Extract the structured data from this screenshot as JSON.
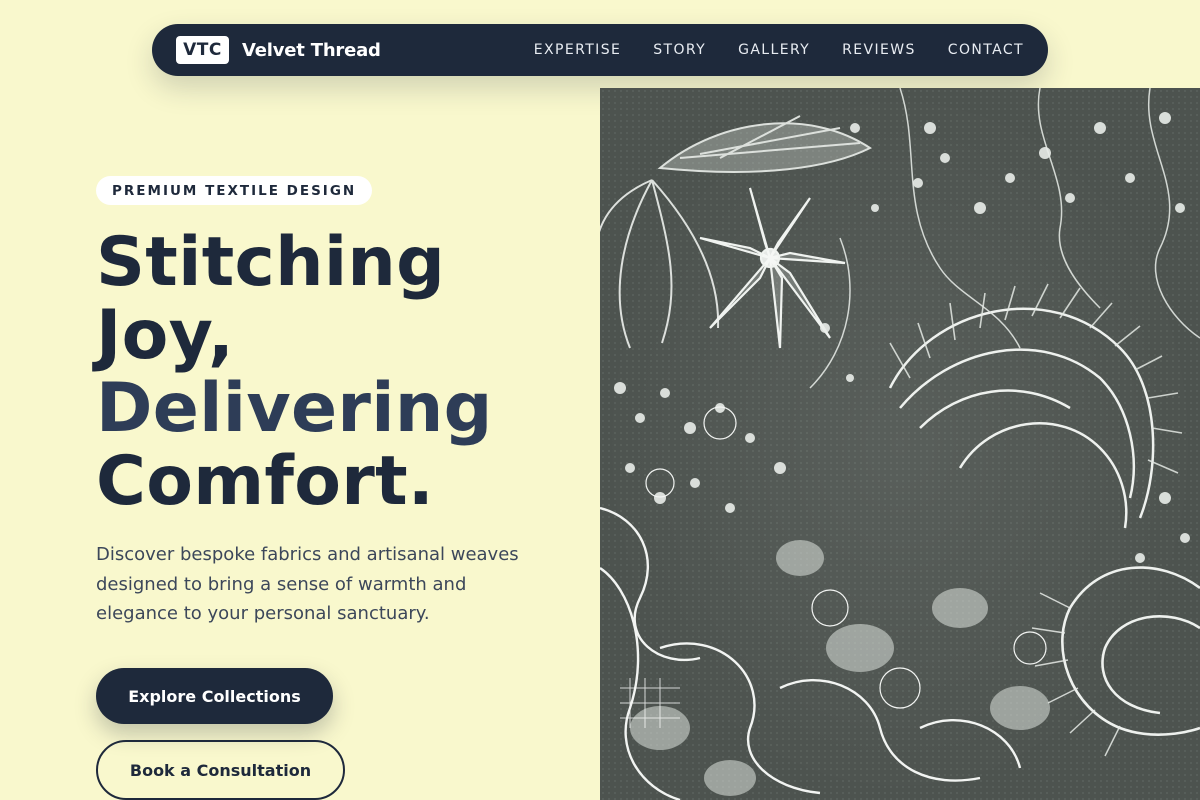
{
  "nav": {
    "logo_badge": "VTC",
    "brand_name": "Velvet Thread",
    "links": [
      "EXPERTISE",
      "STORY",
      "GALLERY",
      "REVIEWS",
      "CONTACT"
    ]
  },
  "hero": {
    "eyebrow": "PREMIUM TEXTILE DESIGN",
    "headline": [
      "Stitching",
      "Joy,",
      "Delivering",
      "Comfort."
    ],
    "description": "Discover bespoke fabrics and artisanal weaves designed to bring a sense of warmth and elegance to your personal sanctuary.",
    "primary_cta": "Explore Collections",
    "secondary_cta": "Book a Consultation"
  },
  "image": {
    "subject": "white floral lace on dark mesh",
    "icon": "lace-photo"
  },
  "colors": {
    "background": "#f9f8cd",
    "navy": "#1e293b",
    "accent_text": "#2e3d57",
    "lace_ground": "#4d534f",
    "lace_white": "#eef1ee"
  }
}
